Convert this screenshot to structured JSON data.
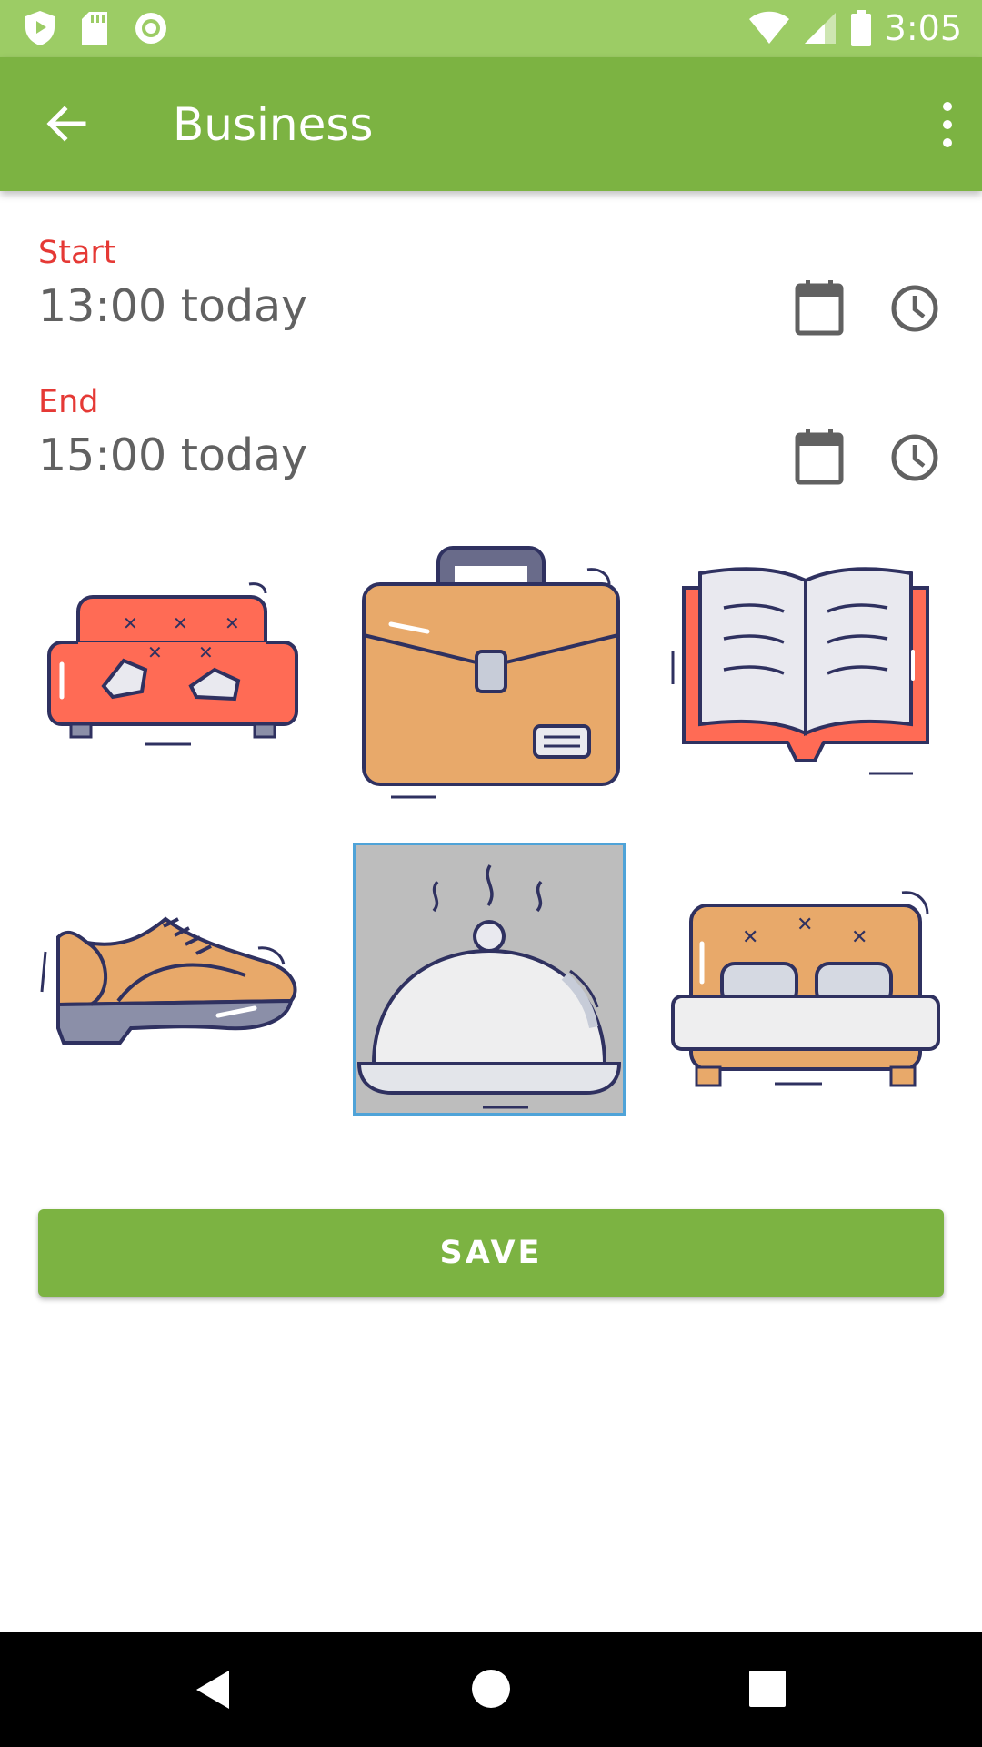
{
  "status_bar": {
    "time": "3:05",
    "icons": [
      "play-protect-icon",
      "sd-card-icon",
      "sync-circle-icon",
      "wifi-icon",
      "cell-signal-icon",
      "battery-icon"
    ],
    "color": "#9ccc65"
  },
  "app_bar": {
    "title": "Business",
    "back_icon": "arrow-back-icon",
    "overflow_icon": "more-vert-icon",
    "color": "#7cb342"
  },
  "start": {
    "label": "Start",
    "value": "13:00 today"
  },
  "end": {
    "label": "End",
    "value": "15:00 today"
  },
  "categories": [
    {
      "icon": "sofa-icon",
      "selected": false
    },
    {
      "icon": "briefcase-icon",
      "selected": false
    },
    {
      "icon": "book-icon",
      "selected": false
    },
    {
      "icon": "shoe-icon",
      "selected": false
    },
    {
      "icon": "food-cloche-icon",
      "selected": true
    },
    {
      "icon": "bed-icon",
      "selected": false
    }
  ],
  "save_button": {
    "label": "SAVE"
  },
  "nav_bar": {
    "icons": [
      "back-triangle-icon",
      "home-circle-icon",
      "recents-square-icon"
    ]
  },
  "colors": {
    "accent": "#7cb342",
    "label_red": "#e53935",
    "selection_border": "#4fa3d8",
    "selection_fill": "#bdbdbd"
  }
}
